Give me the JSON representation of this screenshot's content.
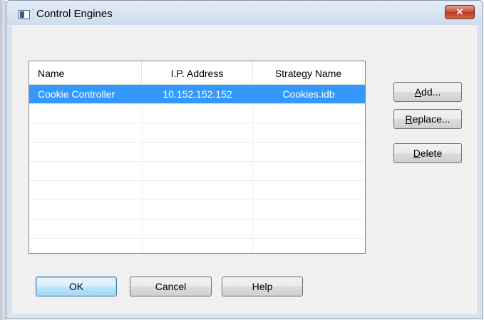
{
  "window": {
    "title": "Control Engines",
    "close_glyph": "✕"
  },
  "list": {
    "columns": [
      "Name",
      "I.P. Address",
      "Strategy Name"
    ],
    "rows": [
      {
        "name": "Cookie Controller",
        "ip": "10.152.152.152",
        "strategy": "Cookies.idb",
        "selected": true
      }
    ],
    "empty_rows": 7
  },
  "side_buttons": {
    "add": {
      "mnemonic": "A",
      "rest": "dd..."
    },
    "replace": {
      "mnemonic": "R",
      "rest": "eplace..."
    },
    "delete": {
      "mnemonic": "D",
      "rest": "elete"
    }
  },
  "bottom_buttons": {
    "ok": "OK",
    "cancel": "Cancel",
    "help": "Help"
  },
  "colors": {
    "selection": "#3399ff",
    "close_button": "#c7492f",
    "dialog_bg": "#f0f0f0",
    "titlebar": "#d7e3f1"
  },
  "icons": [
    "app-window-icon",
    "close-icon"
  ]
}
